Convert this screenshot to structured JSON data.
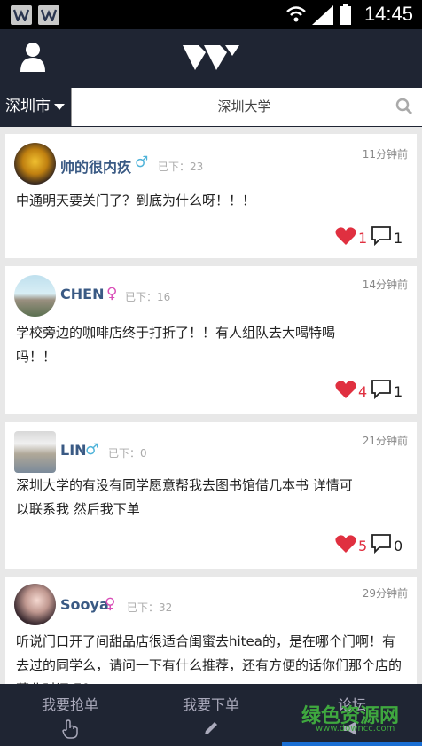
{
  "status": {
    "time": "14:45"
  },
  "header": {
    "logo_icon": "w-logo-icon",
    "profile_icon": "user-icon"
  },
  "search": {
    "city": "深圳市",
    "query": "深圳大学"
  },
  "posts": [
    {
      "name": "帅的很内疚",
      "gender": "♂",
      "under_label": "已下：23",
      "ago": "11分钟前",
      "content": "中通明天要关门了？到底为什么呀！！！",
      "likes": "1",
      "comments": "1"
    },
    {
      "name": "CHEN",
      "gender": "♀",
      "under_label": "已下：16",
      "ago": "14分钟前",
      "content": "学校旁边的咖啡店终于打折了！！有人组队去大喝特喝吗！！",
      "likes": "4",
      "comments": "1"
    },
    {
      "name": "LIN",
      "gender": "♂",
      "under_label": "已下：0",
      "ago": "21分钟前",
      "content": "深圳大学的有没有同学愿意帮我去图书馆借几本书 详情可以联系我 然后我下单",
      "likes": "5",
      "comments": "0"
    },
    {
      "name": "Sooya",
      "gender": "♀",
      "under_label": "已下：32",
      "ago": "29分钟前",
      "content": "听说门口开了间甜品店很适合闺蜜去hitea的，是在哪个门啊！有去过的同学么，请问一下有什么推荐，还有方便的话你们那个店的营业时间吗？",
      "likes": "",
      "comments": ""
    }
  ],
  "tabs": [
    {
      "label": "我要抢单",
      "icon": "hand-pointer-icon"
    },
    {
      "label": "我要下单",
      "icon": "pencil-icon"
    },
    {
      "label": "论坛",
      "icon": "megaphone-icon"
    }
  ],
  "watermark": {
    "text": "绿色资源网",
    "url_text": "www.downcc.com"
  },
  "colors": {
    "bar": "#1f2533",
    "like": "#e03040",
    "male": "#4fb3d9",
    "female": "#d94fb8",
    "active_tab": "#1a6fd4"
  }
}
